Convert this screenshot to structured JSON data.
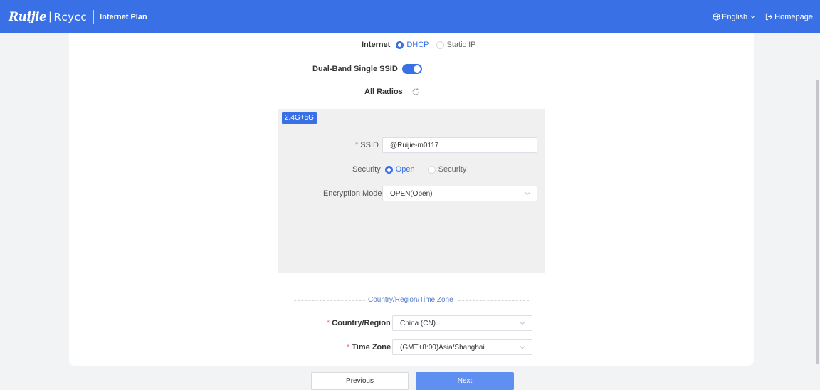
{
  "header": {
    "logo_ruijie": "Ruijie",
    "logo_separator": "|",
    "logo_reyee": "Rcycc",
    "title": "Internet Plan",
    "language": "English",
    "homepage": "Homepage"
  },
  "internet": {
    "label": "Internet",
    "options": [
      "DHCP",
      "Static IP"
    ],
    "selected": "DHCP"
  },
  "dual_band": {
    "label": "Dual-Band Single SSID",
    "enabled": true
  },
  "all_radios": {
    "label": "All Radios"
  },
  "radio_panel": {
    "badge": "2.4G+5G",
    "ssid_label": "SSID",
    "ssid_value": "@Ruijie-m0117",
    "security_label": "Security",
    "security_options": [
      "Open",
      "Security"
    ],
    "security_selected": "Open",
    "encryption_label": "Encryption Mode",
    "encryption_value": "OPEN(Open)"
  },
  "region_section": {
    "title": "Country/Region/Time Zone",
    "country_label": "Country/Region",
    "country_value": "China (CN)",
    "timezone_label": "Time Zone",
    "timezone_value": "(GMT+8:00)Asia/Shanghai"
  },
  "required_mark": "*",
  "footer": {
    "previous": "Previous",
    "next": "Next"
  },
  "colors": {
    "primary": "#3a70e6",
    "next_button": "#5f8ff0",
    "required": "#f56c6c"
  }
}
